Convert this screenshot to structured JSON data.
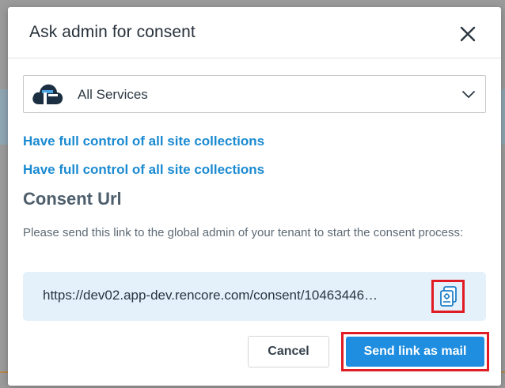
{
  "modal": {
    "title": "Ask admin for consent",
    "close_icon": "close-icon"
  },
  "service_select": {
    "selected": "All Services",
    "icon": "cloud-services-icon",
    "chevron": "chevron-down-icon"
  },
  "permissions": [
    "Have full control of all site collections",
    "Have full control of all site collections"
  ],
  "consent": {
    "section_title": "Consent Url",
    "instruction": "Please send this link to the global admin of your tenant to start the consent process:",
    "url": "https://dev02.app-dev.rencore.com/consent/10463446…",
    "copy_icon": "copy-icon"
  },
  "footer": {
    "cancel_label": "Cancel",
    "send_label": "Send link as mail"
  },
  "colors": {
    "link": "#1a8ad1",
    "primary": "#1f8ee0",
    "highlight": "#e01b24",
    "url_bg": "#e4f1fb"
  }
}
